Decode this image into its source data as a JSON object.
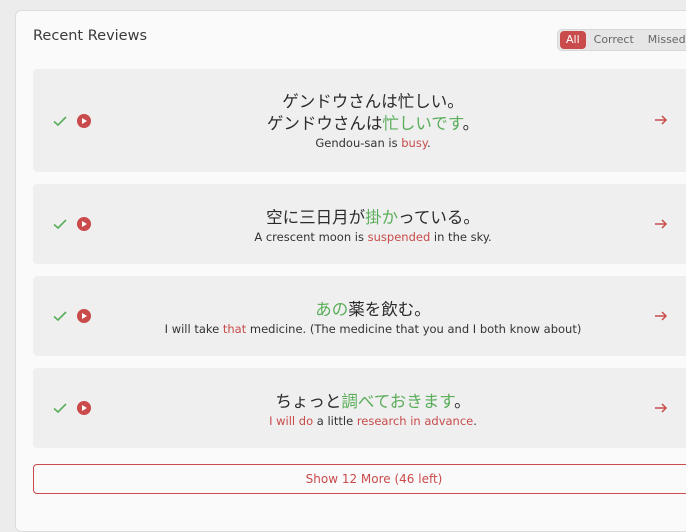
{
  "panel": {
    "title": "Recent Reviews"
  },
  "filters": {
    "all": "All",
    "correct": "Correct",
    "missed": "Missed"
  },
  "reviews": [
    {
      "jp_line1": "ゲンドウさんは忙しい。",
      "jp_line2": {
        "a": "ゲンドウさんは",
        "b": "忙しいです",
        "c": "。"
      },
      "en": {
        "a": "Gendou-san is ",
        "b": "busy",
        "c": "."
      }
    },
    {
      "jp": {
        "a": "空に三日月が",
        "b": "掛か",
        "c": "っている。"
      },
      "en": {
        "a": "A crescent moon is ",
        "b": "suspended",
        "c": " in the sky."
      }
    },
    {
      "jp": {
        "a": "あの",
        "b": "薬を飲む。"
      },
      "en": {
        "a": "I will take ",
        "b": "that",
        "c": " medicine. (The medicine that you and I both know about)"
      }
    },
    {
      "jp": {
        "a": "ちょっと",
        "b": "調べておきます",
        "c": "。"
      },
      "en": {
        "a": "I will do",
        "b": " a little ",
        "c": "research in advance",
        "d": "."
      }
    }
  ],
  "show_more": "Show 12 More (46 left)",
  "colors": {
    "accent": "#c94b4b",
    "highlight": "#5aad5a"
  },
  "icons": {
    "status": "check-icon",
    "audio": "play-icon",
    "open": "arrow-right-icon"
  }
}
